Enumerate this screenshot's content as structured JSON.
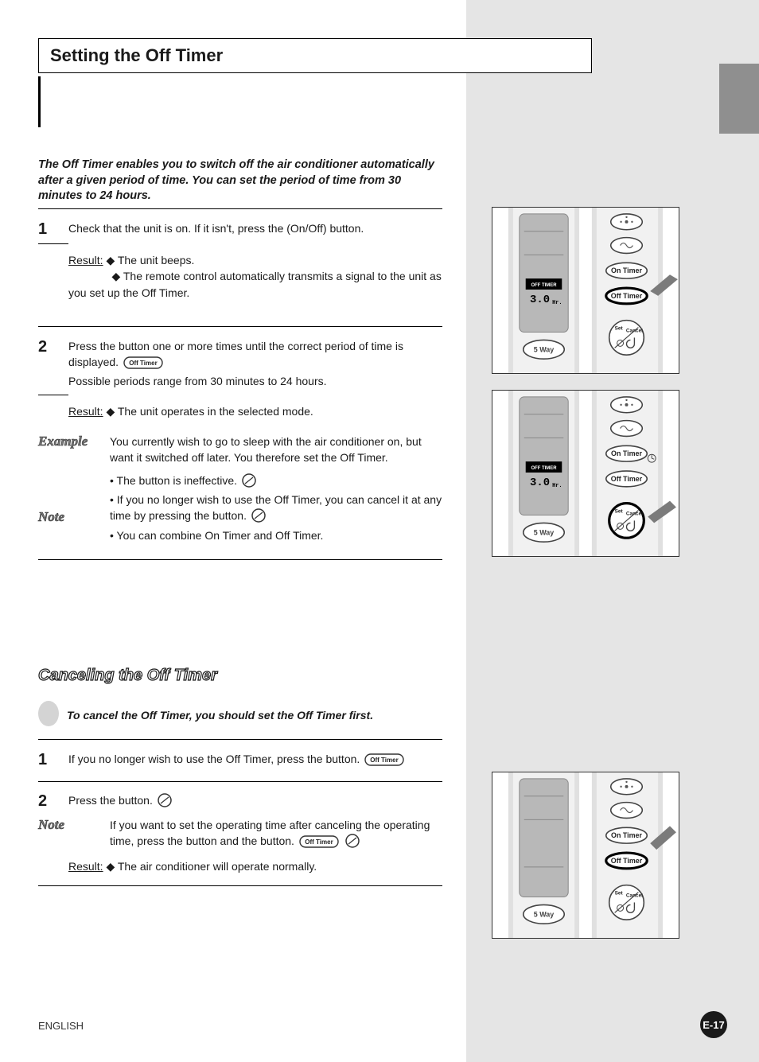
{
  "language_label": "ENGLISH",
  "page_number": "E-17",
  "title": "Setting the Off Timer",
  "intro": "The Off Timer enables you to switch off the air conditioner automatically after a given period of time. You can set the period of time from 30 minutes to 24 hours.",
  "set": {
    "step1": {
      "text": "Check that the unit is on. If it isn't, press the           (On/Off) button.",
      "result_a": "The unit beeps.",
      "result_b": "The remote control automatically transmits a signal to the unit as you set up the Off Timer."
    },
    "step2": {
      "line_a": "Press the           button one or more times until the correct period of time is displayed.",
      "line_b": "Possible periods range from 30 minutes to 24 hours.",
      "result": "The unit operates in the selected mode."
    },
    "example_body": "You currently wish to go to sleep with the air conditioner on, but want it switched off later. You therefore set the Off Timer.",
    "note_line1": "• The        button is ineffective.",
    "note_line2": "• If you no longer wish to use the Off Timer, you can cancel it at any time by pressing the        button.",
    "note_line3": "• You can combine On Timer and Off Timer."
  },
  "sub_title": "Canceling the Off Timer",
  "cancel": {
    "bullet_text": "To cancel the Off Timer, you should set the Off Timer first.",
    "step1_text": "If you no longer wish to use the Off Timer, press the           button.",
    "step2_text": "Press the        button.",
    "note_text": "If you want to set the operating time after canceling the operating time, press the         button and the        button.",
    "result": "The air conditioner will operate normally."
  },
  "remote": {
    "on_timer": "On Timer",
    "off_timer": "Off Timer",
    "five_way": "5 Way",
    "lcd_label": "OFF TIMER",
    "lcd_value": "3.0",
    "lcd_unit": "Hr.",
    "set_cancel": "Set/Cancel"
  }
}
